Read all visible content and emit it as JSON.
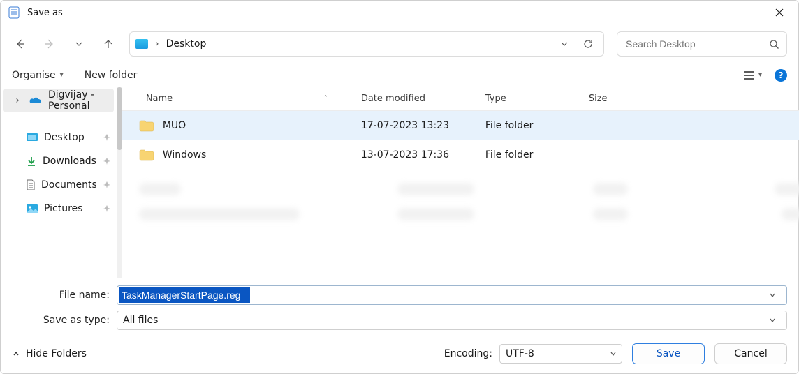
{
  "window": {
    "title": "Save as"
  },
  "addressbar": {
    "location": "Desktop"
  },
  "search": {
    "placeholder": "Search Desktop"
  },
  "toolbar": {
    "organise": "Organise",
    "new_folder": "New folder"
  },
  "sidebar": {
    "account": "Digvijay - Personal",
    "quick": [
      {
        "label": "Desktop"
      },
      {
        "label": "Downloads"
      },
      {
        "label": "Documents"
      },
      {
        "label": "Pictures"
      }
    ]
  },
  "columns": {
    "name": "Name",
    "date": "Date modified",
    "type": "Type",
    "size": "Size"
  },
  "files": [
    {
      "name": "MUO",
      "date": "17-07-2023 13:23",
      "type": "File folder",
      "size": ""
    },
    {
      "name": "Windows",
      "date": "13-07-2023 17:36",
      "type": "File folder",
      "size": ""
    }
  ],
  "form": {
    "file_name_label": "File name:",
    "file_name_value": "TaskManagerStartPage.reg",
    "save_as_type_label": "Save as type:",
    "save_as_type_value": "All files"
  },
  "bottom": {
    "hide_folders": "Hide Folders",
    "encoding_label": "Encoding:",
    "encoding_value": "UTF-8",
    "save": "Save",
    "cancel": "Cancel"
  }
}
